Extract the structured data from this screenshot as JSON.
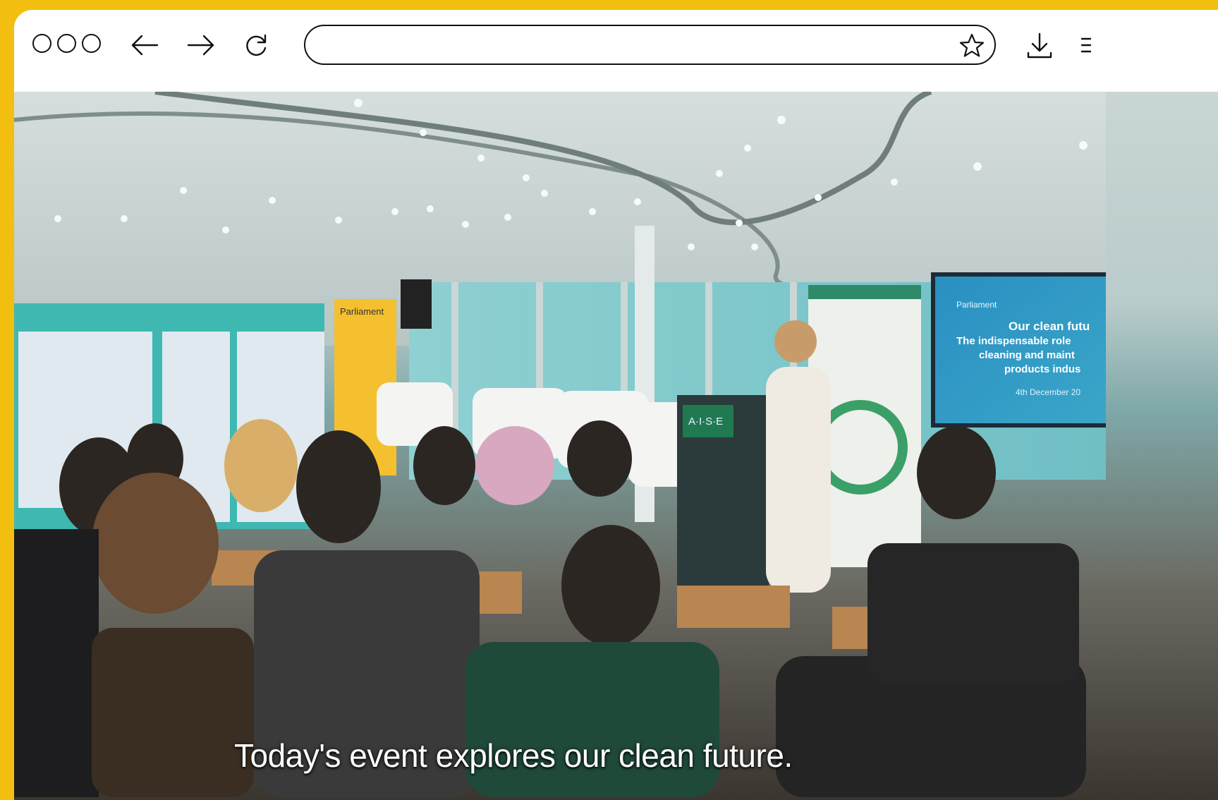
{
  "browser": {
    "window_controls": [
      "circle-1",
      "circle-2",
      "circle-3"
    ],
    "nav": {
      "back_icon": "arrow-left-icon",
      "forward_icon": "arrow-right-icon",
      "reload_icon": "reload-icon"
    },
    "address_bar": {
      "value": "",
      "bookmark_icon": "star-icon"
    },
    "actions": {
      "download_icon": "download-icon",
      "menu_icon": "menu-icon"
    }
  },
  "video": {
    "caption": "Today's event explores our clean future.",
    "banner_brand": "Parliament",
    "screen": {
      "brand": "Parliament",
      "headline": "Our clean futu",
      "subline_1": "The indispensable role",
      "subline_2": "cleaning and maint",
      "subline_3": "products indus",
      "date": "4th December 20"
    },
    "lectern_logo": "A·I·S·E"
  },
  "colors": {
    "frame": "#F2BE0F",
    "chrome": "#FFFFFF",
    "stroke": "#111111"
  }
}
